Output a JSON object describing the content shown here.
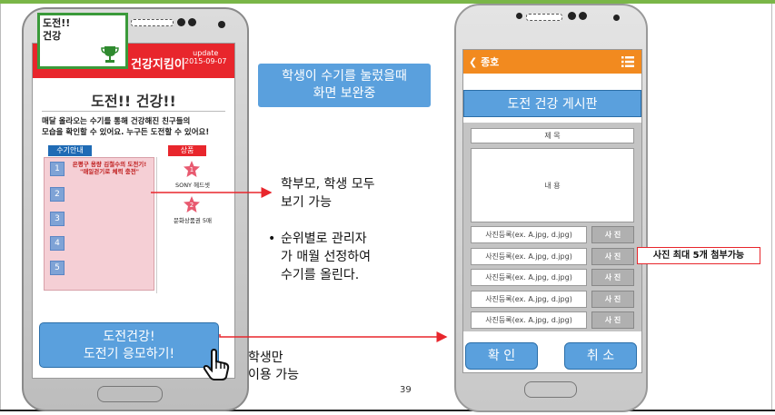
{
  "left_phone": {
    "header_title": "건강지킴이",
    "update_label": "update",
    "update_date": "2015-09-07",
    "badge_line1": "도전!!",
    "badge_line2": "건강",
    "page_title": "도전!! 건강!!",
    "description_line1": "매달 올라오는 수기를 통해 건강해진 친구들의",
    "description_line2": "모습을 확인할 수 있어요. 누구든 도전할 수 있어요!",
    "tab_guide": "수기안내",
    "tab_prize": "상품",
    "list_numbers": [
      "1",
      "2",
      "3",
      "4",
      "5"
    ],
    "first_entry_line1": "은평구 용량 김철수의 도전기!",
    "first_entry_line2": "\"매일걷기로 체력 충전\"",
    "prizes": [
      {
        "rank": "1",
        "name": "SONY 헤드셋"
      },
      {
        "rank": "2",
        "name": "문화상품권 5매"
      }
    ],
    "apply_button_line1": "도전건강!",
    "apply_button_line2": "도전기 응모하기!"
  },
  "annotations": {
    "callout_line1": "학생이 수기를 눌렀을때",
    "callout_line2": "화면 보완중",
    "view_line1": "학부모, 학생 모두",
    "view_line2": "보기 가능",
    "bullet": "•",
    "admin_line1": "순위별로 관리자",
    "admin_line2": "가 매월 선정하여",
    "admin_line3": "수기를 올린다.",
    "student_line1": "학생만",
    "student_line2": "이용 가능",
    "page_number": "39",
    "photo_note": "사진 최대 5개 첨부가능"
  },
  "right_phone": {
    "back_label": "종호",
    "board_title": "도전 건강 게시판",
    "title_field": "제    목",
    "content_field": "내    용",
    "photo_placeholder": "사진등록(ex. A.jpg, d.jpg)",
    "photo_button": "사 진",
    "confirm_button": "확  인",
    "cancel_button": "취  소"
  },
  "colors": {
    "red": "#e8262c",
    "blue": "#5aa0dd",
    "orange": "#f28a1f",
    "green": "#3a9a3a"
  }
}
